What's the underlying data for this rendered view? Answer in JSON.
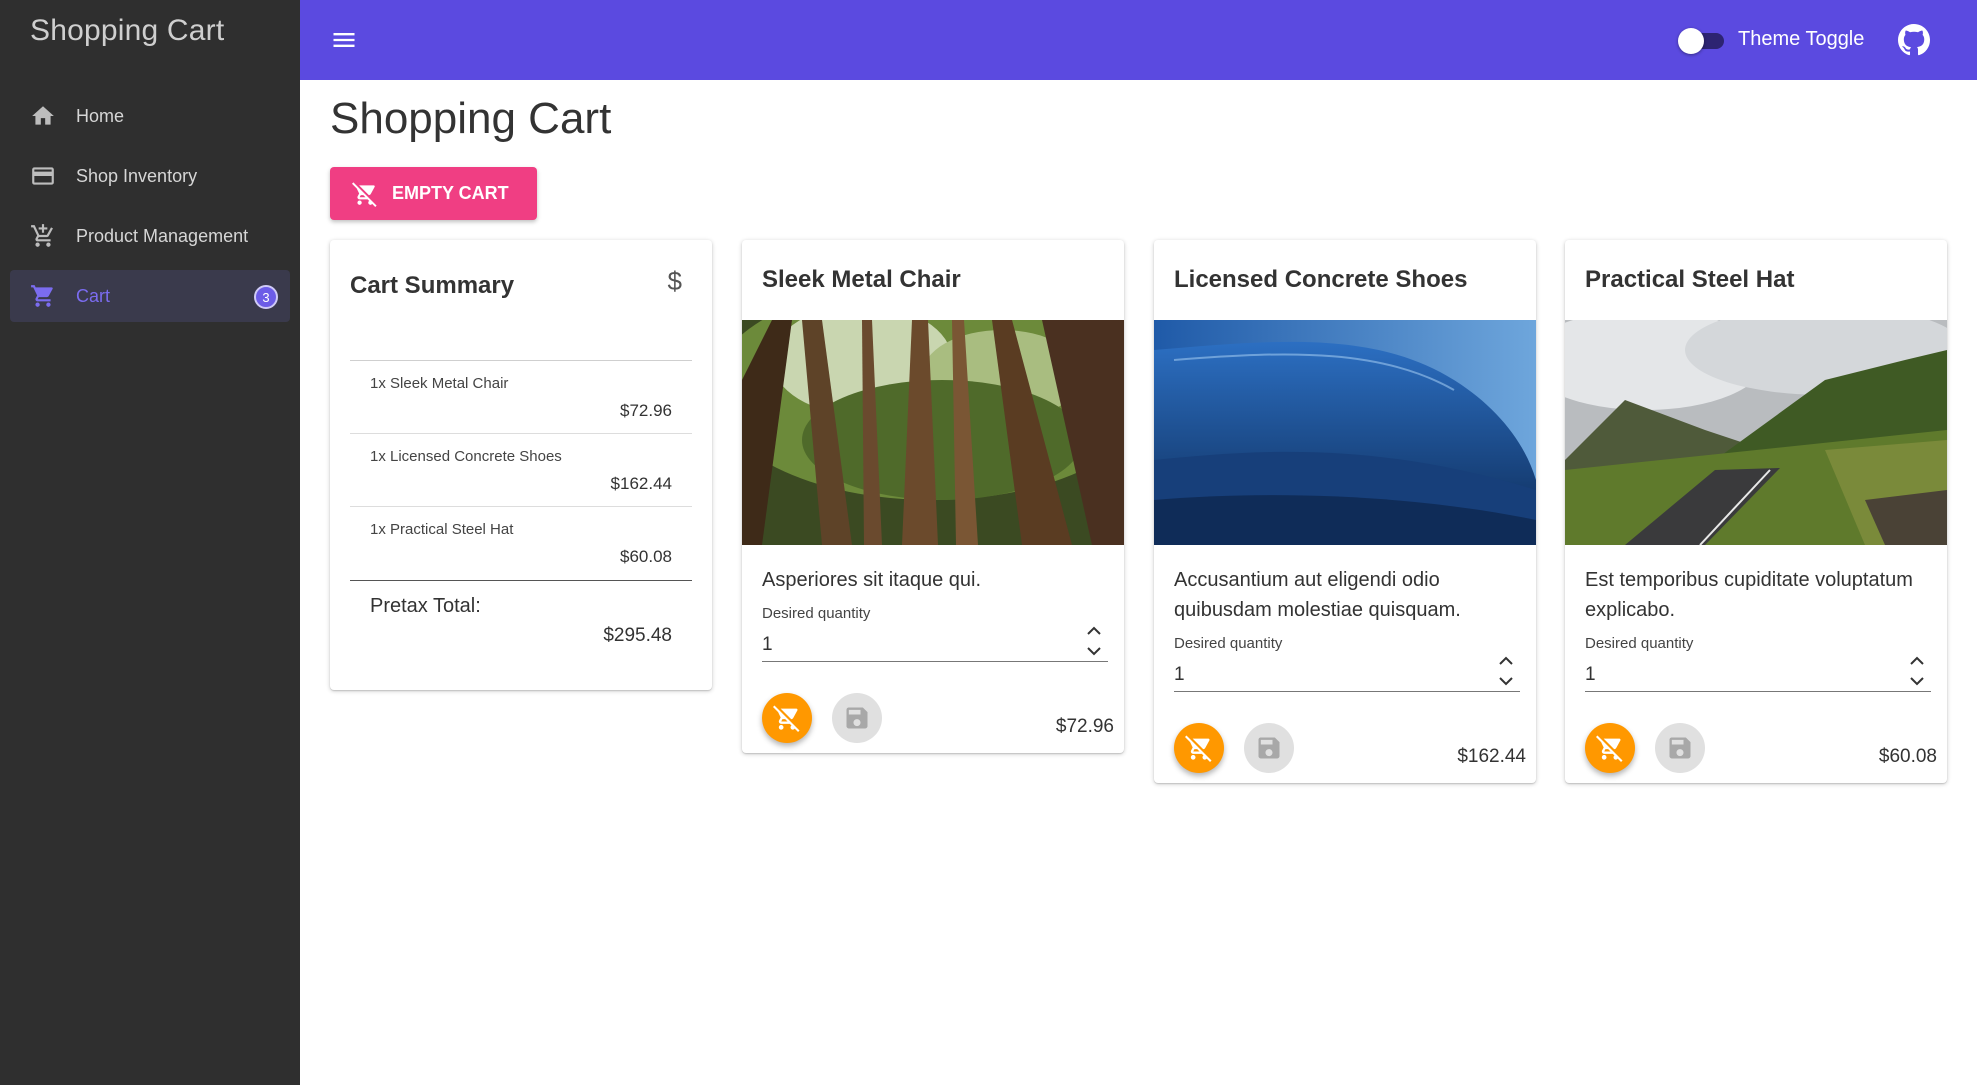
{
  "sidebar": {
    "brand": "Shopping Cart",
    "items": [
      {
        "label": "Home",
        "icon": "home-icon"
      },
      {
        "label": "Shop Inventory",
        "icon": "credit-card-icon"
      },
      {
        "label": "Product Management",
        "icon": "add-shopping-cart-icon"
      },
      {
        "label": "Cart",
        "icon": "shopping-cart-icon",
        "badge": "3",
        "active": true
      }
    ]
  },
  "topbar": {
    "menu_icon": "menu-icon",
    "toggle_label": "Theme Toggle",
    "github_icon": "github-icon",
    "accent_color": "#5b4ae0"
  },
  "main": {
    "title": "Shopping Cart",
    "empty_cart_label": "EMPTY CART"
  },
  "summary": {
    "title": "Cart Summary",
    "icon": "dollar-icon",
    "items": [
      {
        "name": "1x Sleek Metal Chair",
        "price": "$72.96"
      },
      {
        "name": "1x Licensed Concrete Shoes",
        "price": "$162.44"
      },
      {
        "name": "1x Practical Steel Hat",
        "price": "$60.08"
      }
    ],
    "pretax_label": "Pretax Total:",
    "pretax_value": "$295.48"
  },
  "products": [
    {
      "title": "Sleek Metal Chair",
      "image": "forest-canopy",
      "description": "Asperiores sit itaque qui.",
      "qty_label": "Desired quantity",
      "qty": "1",
      "price": "$72.96"
    },
    {
      "title": "Licensed Concrete Shoes",
      "image": "ocean-wave",
      "description": "Accusantium aut eligendi odio quibusdam molestiae quisquam.",
      "qty_label": "Desired quantity",
      "qty": "1",
      "price": "$162.44"
    },
    {
      "title": "Practical Steel Hat",
      "image": "mountain-road",
      "description": "Est temporibus cupiditate voluptatum explicabo.",
      "qty_label": "Desired quantity",
      "qty": "1",
      "price": "$60.08"
    }
  ]
}
